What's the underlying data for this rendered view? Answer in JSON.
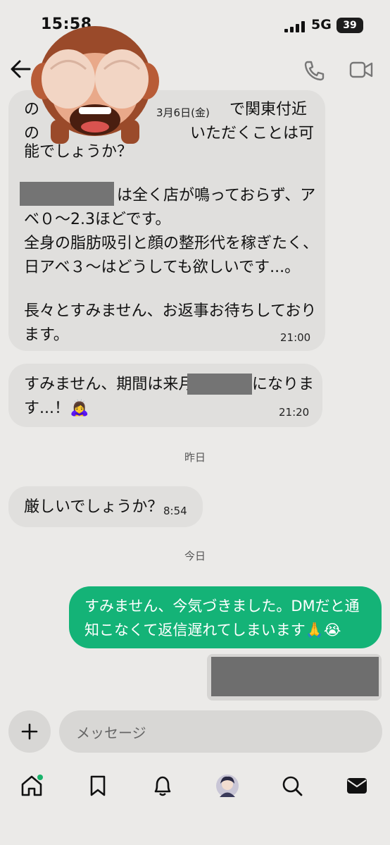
{
  "status_bar": {
    "time": "15:58",
    "network": "5G",
    "battery": "39"
  },
  "chat": {
    "date_label": "3月6日(金)",
    "message1": {
      "lines_top": [
        {
          "left": "の",
          "right": "で関東付近"
        },
        {
          "left": "の",
          "right": "いただくことは可"
        }
      ],
      "line3": "能でしょうか？",
      "para2_line1_suffix": "は全く店が鳴っておらず、ア",
      "para2_line2": "ベ０～2.3ほどです。",
      "para2_line3": "全身の脂肪吸引と顔の整形代を稼ぎたく、",
      "para2_line4": "日アベ３～はどうしても欲しいです...。",
      "para3_line1": "長々とすみません、お返事お待ちしており",
      "para3_line2": "ます。",
      "time": "21:00"
    },
    "message2": {
      "line1_prefix": "すみません、期間は来月",
      "line1_suffix": "になりま",
      "line2": "す...！🙇‍♀️",
      "time": "21:20"
    },
    "separator_yesterday": "昨日",
    "message3": {
      "text": "厳しいでしょうか？",
      "time": "8:54"
    },
    "separator_today": "今日",
    "message4": {
      "line1": "すみません、今気づきました。DMだと通",
      "line2": "知こなくて返信遅れてしまいます🙏😭"
    }
  },
  "composer": {
    "placeholder": "メッセージ"
  },
  "nav": {
    "icons": [
      "home-icon",
      "bookmark-icon",
      "bell-icon",
      "profile-avatar",
      "search-icon",
      "inbox-icon"
    ]
  },
  "colors": {
    "background": "#ebeae8",
    "incoming_bubble": "#e0dfdd",
    "outgoing_bubble": "#14b377"
  }
}
